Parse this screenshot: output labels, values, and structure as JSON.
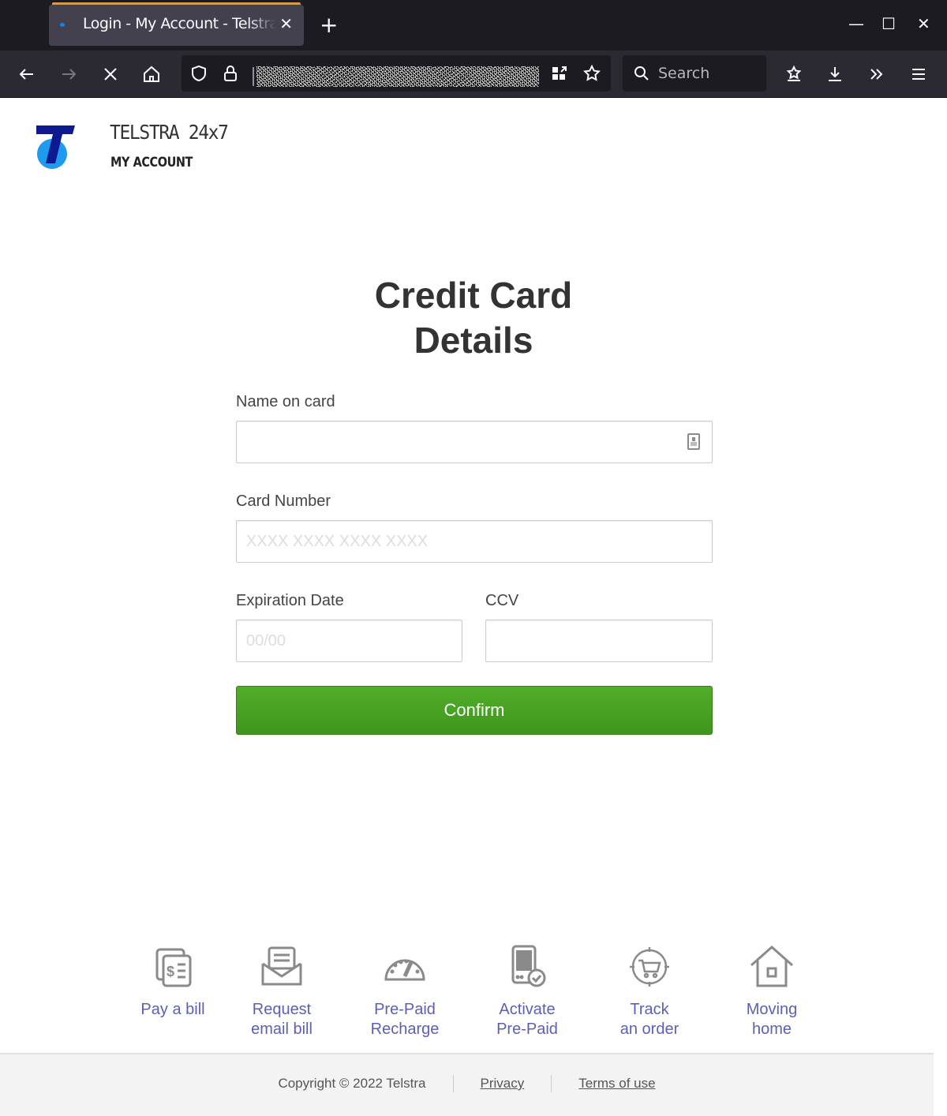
{
  "browser": {
    "tab_title": "Login - My Account - Telstra",
    "new_tab_label": "+",
    "search_placeholder": "Search",
    "window_controls": {
      "minimize": "—",
      "maximize": "☐",
      "close": "✕"
    },
    "tab_close": "✕"
  },
  "brand": {
    "title": "TELSTRA 24x7",
    "subtitle": "MY ACCOUNT",
    "colors": {
      "logo_dark": "#0d1a8f",
      "logo_light": "#1e9bf0"
    }
  },
  "form": {
    "heading_line1": "Credit Card",
    "heading_line2": "Details",
    "name_label": "Name on card",
    "name_value": "",
    "card_label": "Card Number",
    "card_placeholder": "XXXX XXXX XXXX XXXX",
    "expiry_label": "Expiration Date",
    "expiry_placeholder": "00/00",
    "ccv_label": "CCV",
    "ccv_value": "",
    "confirm_label": "Confirm",
    "confirm_color": "#48a323"
  },
  "quicklinks": [
    {
      "label": "Pay a bill",
      "icon": "bill-icon"
    },
    {
      "label": "Request email bill",
      "icon": "email-bill-icon"
    },
    {
      "label": "Pre-Paid Recharge",
      "icon": "speedometer-icon"
    },
    {
      "label": "Activate Pre-Paid",
      "icon": "phone-check-icon"
    },
    {
      "label": "Track an order",
      "icon": "cart-target-icon"
    },
    {
      "label": "Moving home",
      "icon": "house-icon"
    }
  ],
  "footer": {
    "copyright": "Copyright © 2022 Telstra",
    "privacy": "Privacy",
    "terms": "Terms of use"
  }
}
